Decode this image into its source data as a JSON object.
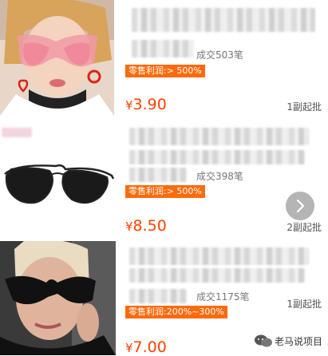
{
  "products": [
    {
      "sales": "成交503笔",
      "badge": "零售利润:> 500%",
      "currency": "¥",
      "price": "3.90",
      "moq": "1副起批"
    },
    {
      "sales": "成交398笔",
      "badge": "零售利润:> 500%",
      "currency": "¥",
      "price": "8.50",
      "moq": "2副起批"
    },
    {
      "sales": "成交1175笔",
      "badge": "零售利润:200%~300%",
      "currency": "¥",
      "price": "7.00",
      "moq": "1副起批"
    }
  ],
  "watermark": {
    "text": "老马说项目"
  },
  "colors": {
    "accent": "#ff4200",
    "badge_bg": "#ff6a0a"
  }
}
